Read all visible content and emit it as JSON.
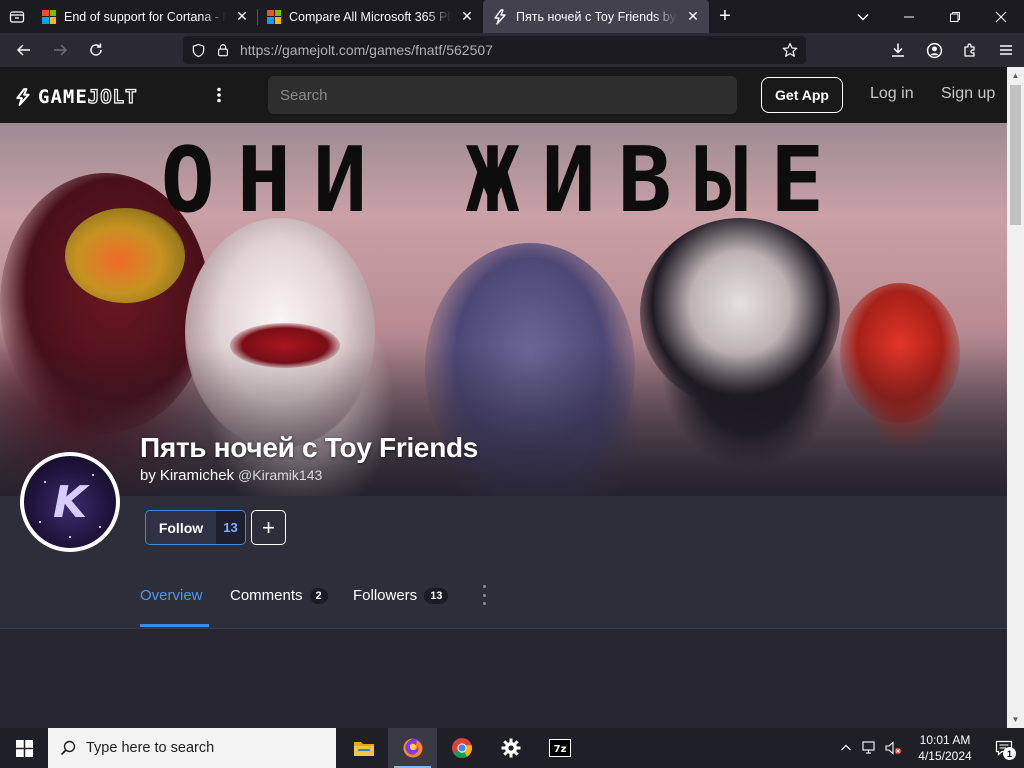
{
  "browser": {
    "tabs": [
      {
        "title": "End of support for Cortana - Mic",
        "favicon": "microsoft-icon"
      },
      {
        "title": "Compare All Microsoft 365 Plans",
        "favicon": "microsoft-icon"
      },
      {
        "title": "Пять ночей с Toy Friends by Kira",
        "favicon": "gamejolt-icon",
        "active": true
      }
    ],
    "url": "https://gamejolt.com/games/fnatf/562507"
  },
  "site": {
    "logo_word_a": "GAME",
    "logo_word_b": "JOLT",
    "search_placeholder": "Search",
    "get_app": "Get App",
    "login": "Log in",
    "signup": "Sign up"
  },
  "game": {
    "banner_caption": "ОНИ ЖИВЫЕ",
    "title": "Пять ночей с Toy Friends",
    "by": "by",
    "author": "Kiramichek",
    "handle": "@Kiramik143",
    "avatar_letter": "K",
    "follow_label": "Follow",
    "follow_count": "13",
    "add_label": "+"
  },
  "page_tabs": [
    {
      "label": "Overview",
      "badge": "",
      "active": true
    },
    {
      "label": "Comments",
      "badge": "2"
    },
    {
      "label": "Followers",
      "badge": "13"
    }
  ],
  "taskbar": {
    "search_placeholder": "Type here to search",
    "time": "10:01 AM",
    "date": "4/15/2024",
    "notification_count": "1"
  },
  "colors": {
    "accent": "#3f8ae8",
    "follow_border": "#4a85d6",
    "header_bg": "#191919",
    "page_bg": "#2e2d3a"
  }
}
